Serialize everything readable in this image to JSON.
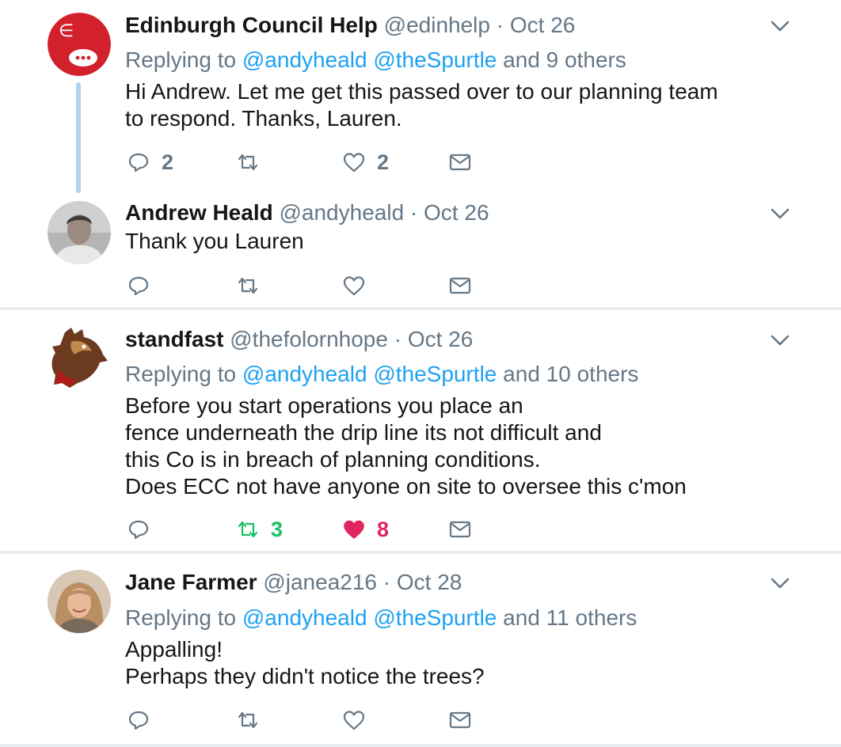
{
  "colors": {
    "link": "#1da1f2",
    "muted": "#657786",
    "retweet_active": "#17bf63",
    "like_active": "#e0245e",
    "thread_line": "#aed4f3"
  },
  "tweets": [
    {
      "name": "Edinburgh Council Help",
      "handle": "@edinhelp",
      "separator": "·",
      "date": "Oct 26",
      "replying": {
        "prefix": "Replying to",
        "mention1": "@andyheald",
        "mention2": "@theSpurtle",
        "suffix": "and 9 others"
      },
      "text": "Hi Andrew. Let me get this passed over to our planning team\nto respond. Thanks, Lauren.",
      "reply_count": "2",
      "retweet_count": "",
      "like_count": "2",
      "avatar_icon": "speech-bubble-logo-icon"
    },
    {
      "name": "Andrew Heald",
      "handle": "@andyheald",
      "separator": "·",
      "date": "Oct 26",
      "text": "Thank you Lauren",
      "reply_count": "",
      "retweet_count": "",
      "like_count": "",
      "avatar_icon": "person-photo-icon"
    },
    {
      "name": "standfast",
      "handle": "@thefolornhope",
      "separator": "·",
      "date": "Oct 26",
      "replying": {
        "prefix": "Replying to",
        "mention1": "@andyheald",
        "mention2": "@theSpurtle",
        "suffix": "and 10 others"
      },
      "text": "Before you start operations you place an\nfence underneath the drip line its not difficult and\nthis Co is in breach of planning conditions.\nDoes ECC not have anyone on site to oversee this c'mon",
      "reply_count": "",
      "retweet_count": "3",
      "like_count": "8",
      "retweeted": true,
      "liked": true,
      "avatar_icon": "heraldic-beast-icon"
    },
    {
      "name": "Jane Farmer",
      "handle": "@janea216",
      "separator": "·",
      "date": "Oct 28",
      "replying": {
        "prefix": "Replying to",
        "mention1": "@andyheald",
        "mention2": "@theSpurtle",
        "suffix": "and 11 others"
      },
      "text": "Appalling!\nPerhaps they didn't notice the trees?",
      "reply_count": "",
      "retweet_count": "",
      "like_count": "",
      "avatar_icon": "person-photo-icon"
    }
  ]
}
